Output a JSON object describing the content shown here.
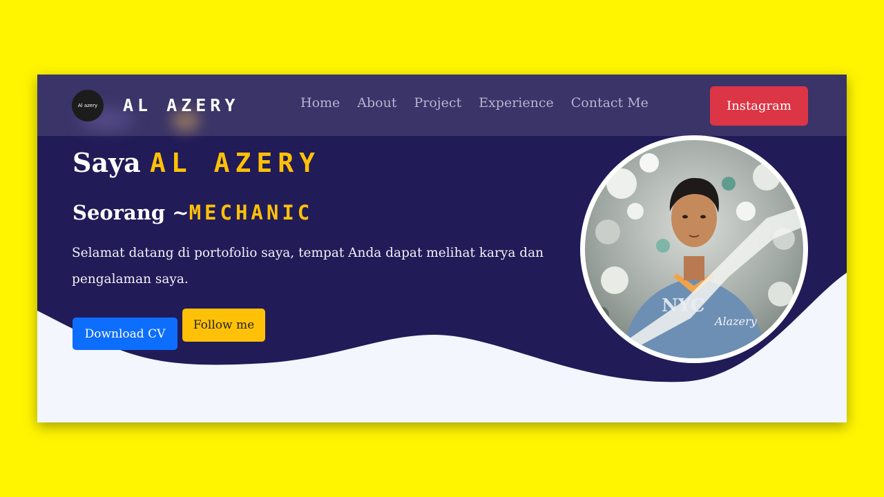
{
  "brand": {
    "logo_text": "Al azery",
    "name": "AL AZERY"
  },
  "nav": {
    "items": [
      "Home",
      "About",
      "Project",
      "Experience",
      "Contact Me"
    ]
  },
  "header": {
    "cta_label": "Instagram"
  },
  "hero": {
    "title_prefix": "Saya",
    "title_name": "AL AZERY",
    "subtitle_prefix": "Seorang ~",
    "subtitle_role": "MECHANIC",
    "description": "Selamat datang di portofolio saya, tempat Anda dapat melihat karya dan pengalaman saya.",
    "download_label": "Download CV",
    "follow_label": "Follow me"
  },
  "photo": {
    "signature": "Alazery",
    "shirt_text": "NYC"
  },
  "colors": {
    "page_bg": "#fff500",
    "hero_bg": "#211b58",
    "navbar_bg": "#3a3468",
    "accent_yellow": "#ffc107",
    "instagram_red": "#dc3545",
    "download_blue": "#0d6efd",
    "wave_light": "#f3f6fd"
  }
}
